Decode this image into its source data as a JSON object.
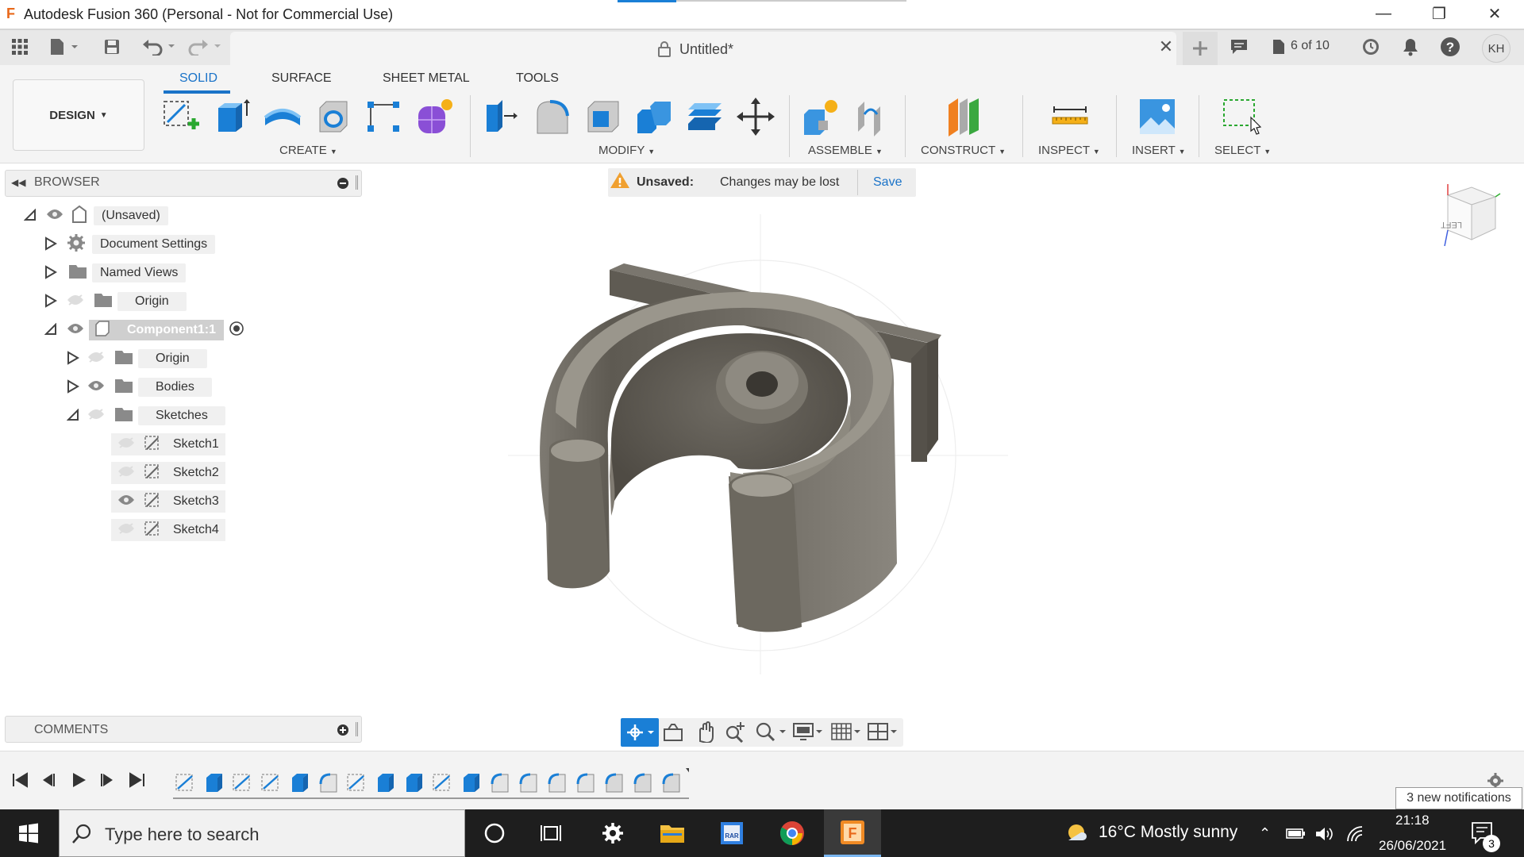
{
  "window": {
    "title": "Autodesk Fusion 360 (Personal - Not for Commercial Use)",
    "app_icon": "F"
  },
  "toolbar": {
    "document_title": "Untitled*",
    "jobs_counter": "6 of 10",
    "user_initials": "KH"
  },
  "ribbon": {
    "workspace": "DESIGN",
    "tabs": [
      "SOLID",
      "SURFACE",
      "SHEET METAL",
      "TOOLS"
    ],
    "groups": {
      "create": "CREATE",
      "modify": "MODIFY",
      "assemble": "ASSEMBLE",
      "construct": "CONSTRUCT",
      "inspect": "INSPECT",
      "insert": "INSERT",
      "select": "SELECT"
    }
  },
  "browser": {
    "title": "BROWSER",
    "items": [
      {
        "label": "(Unsaved)",
        "expanded": true,
        "visible": true
      },
      {
        "label": "Document Settings",
        "expanded": false
      },
      {
        "label": "Named Views",
        "expanded": false
      },
      {
        "label": "Origin",
        "expanded": false,
        "visible": false
      },
      {
        "label": "Component1:1",
        "expanded": true,
        "visible": true,
        "active": true
      },
      {
        "label": "Origin",
        "expanded": false,
        "visible": false
      },
      {
        "label": "Bodies",
        "expanded": false,
        "visible": true
      },
      {
        "label": "Sketches",
        "expanded": true,
        "visible": false
      },
      {
        "label": "Sketch1",
        "visible": false
      },
      {
        "label": "Sketch2",
        "visible": false
      },
      {
        "label": "Sketch3",
        "visible": true
      },
      {
        "label": "Sketch4",
        "visible": false
      }
    ]
  },
  "notice": {
    "status": "Unsaved:",
    "message": "Changes may be lost",
    "action": "Save"
  },
  "viewcube": {
    "face_label": "LEFT"
  },
  "comments": {
    "title": "COMMENTS"
  },
  "timeline": {
    "feature_count": 18
  },
  "notifications": {
    "toast": "3 new notifications",
    "badge": "3"
  },
  "taskbar": {
    "search_placeholder": "Type here to search",
    "weather": "16°C  Mostly sunny",
    "time": "21:18",
    "date": "26/06/2021"
  },
  "colors": {
    "accent": "#1a73c8",
    "warning": "#f0a030",
    "model": "#6e6a62"
  }
}
